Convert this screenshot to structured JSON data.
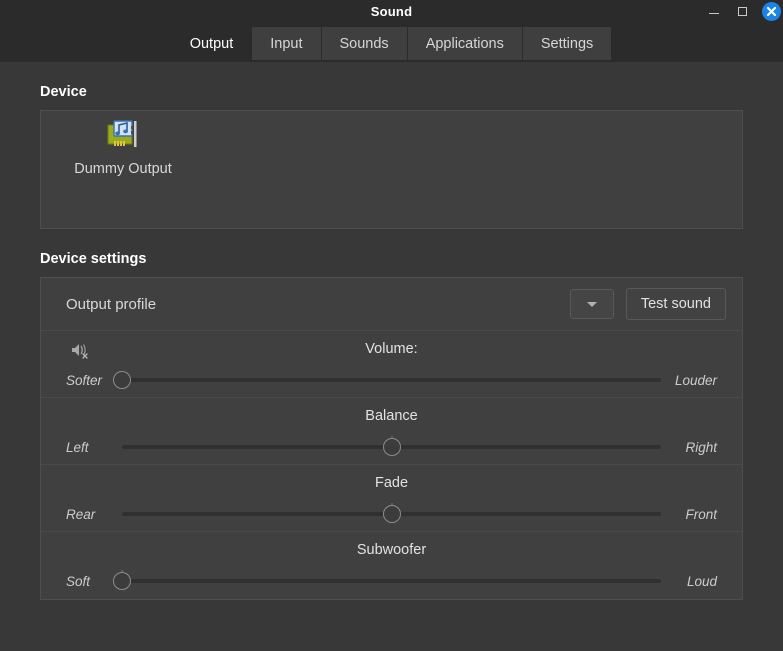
{
  "window": {
    "title": "Sound",
    "controls": {
      "minimize": "minimize",
      "maximize": "maximize",
      "close": "close"
    },
    "accent_color": "#1b84e7"
  },
  "tabs": [
    {
      "label": "Output",
      "active": true
    },
    {
      "label": "Input",
      "active": false
    },
    {
      "label": "Sounds",
      "active": false
    },
    {
      "label": "Applications",
      "active": false
    },
    {
      "label": "Settings",
      "active": false
    }
  ],
  "device_section": {
    "heading": "Device",
    "devices": [
      {
        "name": "Dummy Output",
        "icon": "sound-card-icon"
      }
    ]
  },
  "device_settings": {
    "heading": "Device settings",
    "profile": {
      "label": "Output profile",
      "selected": "",
      "dropdown_icon": "chevron-down-icon"
    },
    "test_button": "Test sound",
    "sliders": [
      {
        "name": "volume",
        "title": "Volume:",
        "icon": "speaker-muted-icon",
        "left_label": "Softer",
        "right_label": "Louder",
        "value": 0,
        "min": 0,
        "max": 100,
        "has_tick": false
      },
      {
        "name": "balance",
        "title": "Balance",
        "icon": "",
        "left_label": "Left",
        "right_label": "Right",
        "value": 50,
        "min": 0,
        "max": 100,
        "has_tick": true
      },
      {
        "name": "fade",
        "title": "Fade",
        "icon": "",
        "left_label": "Rear",
        "right_label": "Front",
        "value": 50,
        "min": 0,
        "max": 100,
        "has_tick": true
      },
      {
        "name": "subwoofer",
        "title": "Subwoofer",
        "icon": "",
        "left_label": "Soft",
        "right_label": "Loud",
        "value": 0,
        "min": 0,
        "max": 100,
        "has_tick": true
      }
    ]
  }
}
